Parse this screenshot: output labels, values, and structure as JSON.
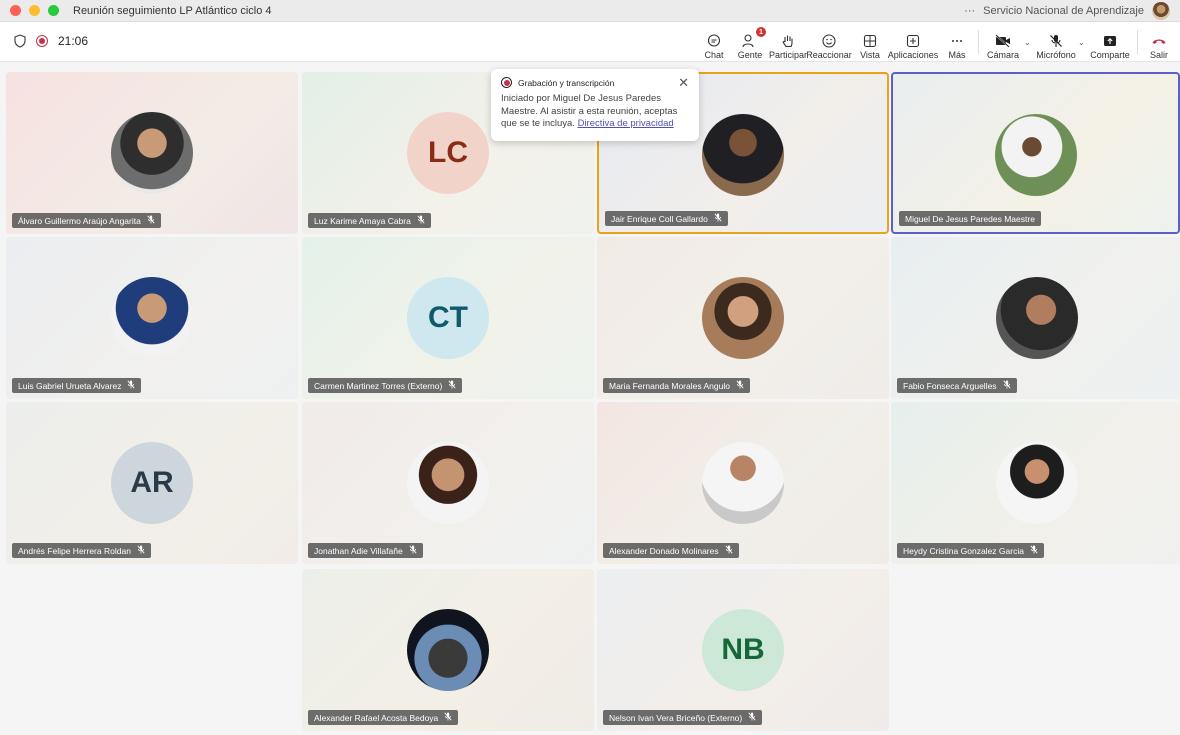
{
  "window": {
    "title": "Reunión seguimiento LP Atlántico ciclo 4",
    "org": "Servicio Nacional de Aprendizaje",
    "more": "···"
  },
  "toolbar": {
    "timer": "21:06",
    "chat": "Chat",
    "people": "Gente",
    "people_badge": "1",
    "raise_hand": "Participar",
    "react": "Reaccionar",
    "view": "Vista",
    "apps": "Aplicaciones",
    "more": "Más",
    "camera": "Cámara",
    "mic": "Micrófono",
    "share": "Comparte",
    "leave": "Salir"
  },
  "notification": {
    "title": "Grabación y transcripción",
    "body": "Iniciado por Miguel De Jesus Paredes Maestre. Al asistir a esta reunión, aceptas que se te incluya.",
    "link": "Directiva de privacidad"
  },
  "participants": [
    {
      "name": "Álvaro Guillermo Araújo Angarita",
      "initials": "",
      "muted": true
    },
    {
      "name": "Luz Karime Amaya Cabra",
      "initials": "LC",
      "muted": true
    },
    {
      "name": "Jair Enrique Coll Gallardo",
      "initials": "",
      "muted": true
    },
    {
      "name": "Miguel De Jesus Paredes Maestre",
      "initials": "",
      "muted": false
    },
    {
      "name": "Luis Gabriel Urueta Alvarez",
      "initials": "",
      "muted": true
    },
    {
      "name": "Carmen Martinez Torres (Externo)",
      "initials": "CT",
      "muted": true
    },
    {
      "name": "Maria Fernanda Morales Angulo",
      "initials": "",
      "muted": true
    },
    {
      "name": "Fabio Fonseca Arguelles",
      "initials": "",
      "muted": true
    },
    {
      "name": "Andrés Felipe Herrera Roldan",
      "initials": "AR",
      "muted": true
    },
    {
      "name": "Jonathan Adie Villafañe",
      "initials": "",
      "muted": true
    },
    {
      "name": "Alexander Donado Molinares",
      "initials": "",
      "muted": true
    },
    {
      "name": "Heydy Cristina Gonzalez Garcia",
      "initials": "",
      "muted": true
    },
    {
      "name": "Alexander Rafael Acosta Bedoya",
      "initials": "",
      "muted": true
    },
    {
      "name": "Nelson Ivan Vera Briceño (Externo)",
      "initials": "NB",
      "muted": true
    }
  ],
  "colors": {
    "accent": "#5b5fc7",
    "speaking": "#e8a419",
    "leave": "#c4314b",
    "avatar_lc_bg": "#f2d3c9",
    "avatar_lc_fg": "#8a2b16",
    "avatar_ct_bg": "#cfe7ee",
    "avatar_ct_fg": "#0f5a6b",
    "avatar_ar_bg": "#cdd6dd",
    "avatar_ar_fg": "#2b3a47",
    "avatar_nb_bg": "#cde8d7",
    "avatar_nb_fg": "#16683b"
  }
}
